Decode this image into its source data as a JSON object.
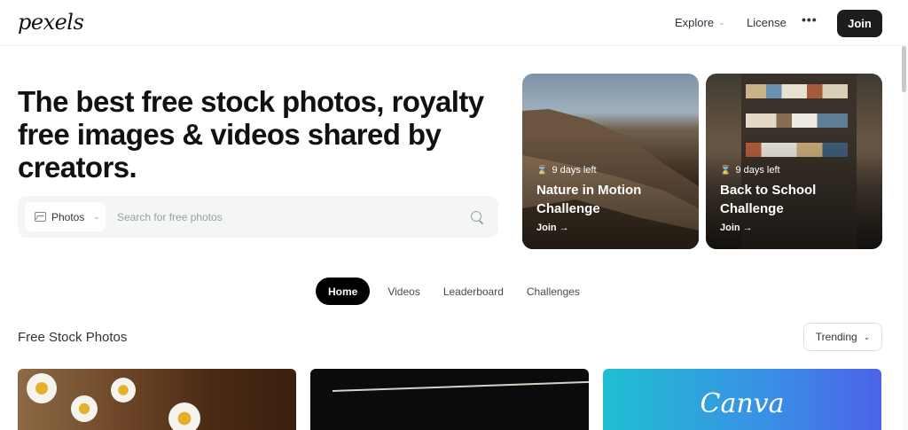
{
  "header": {
    "logo": "pexels",
    "nav": {
      "explore": "Explore",
      "license": "License",
      "more": "•••"
    },
    "join_label": "Join"
  },
  "hero": {
    "title": "The best free stock photos, royalty free images & videos shared by creators."
  },
  "search": {
    "type_label": "Photos",
    "placeholder": "Search for free photos"
  },
  "challenges": [
    {
      "meta": "9 days left",
      "title": "Nature in Motion Challenge",
      "join": "Join →"
    },
    {
      "meta": "9 days left",
      "title": "Back to School Challenge",
      "join": "Join →"
    }
  ],
  "tabs": [
    {
      "label": "Home",
      "active": true
    },
    {
      "label": "Videos",
      "active": false
    },
    {
      "label": "Leaderboard",
      "active": false
    },
    {
      "label": "Challenges",
      "active": false
    }
  ],
  "feed": {
    "title": "Free Stock Photos",
    "sort_label": "Trending"
  },
  "photos": {
    "canva_logo": "Canva"
  },
  "colors": {
    "primary_dark": "#1d1d1d",
    "search_bg": "#f4f5f5",
    "text": "#2c343e"
  }
}
